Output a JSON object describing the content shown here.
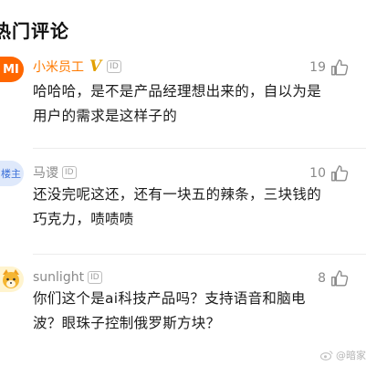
{
  "section": {
    "title": "热门评论"
  },
  "comments": [
    {
      "avatar_text": "MI",
      "username": "小米员工",
      "vip_mark": "V",
      "id_badge": "ID",
      "likes": "19",
      "text": "哈哈哈，是不是产品经理想出来的，自以为是用户的需求是这样子的"
    },
    {
      "avatar_text": "楼主",
      "username": "马谡",
      "id_badge": "ID",
      "likes": "10",
      "text": "还没完呢这还，还有一块五的辣条，三块钱的巧克力，啧啧啧"
    },
    {
      "avatar_text": "",
      "username": "sunlight",
      "id_badge": "ID",
      "likes": "8",
      "text": "你们这个是ai科技产品吗？支持语音和脑电波？眼珠子控制俄罗斯方块？"
    }
  ],
  "watermark": {
    "text": "@暗家"
  },
  "colors": {
    "vip_name": "#ff7a00",
    "name": "#8a8a8a",
    "accent_mi": "#ff6700"
  }
}
